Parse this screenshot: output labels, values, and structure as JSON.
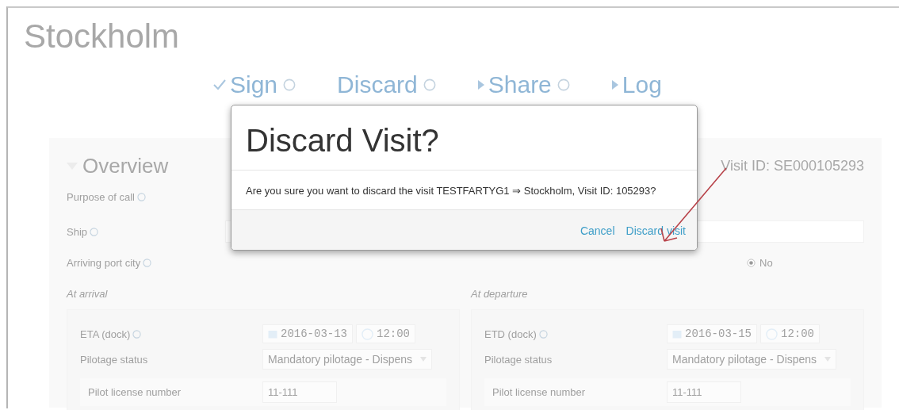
{
  "page": {
    "title": "Stockholm"
  },
  "actions": [
    {
      "kind": "check",
      "label": "Sign",
      "help": true
    },
    {
      "kind": "plain",
      "label": "Discard",
      "help": true
    },
    {
      "kind": "caret",
      "label": "Share",
      "help": true
    },
    {
      "kind": "caret",
      "label": "Log",
      "help": false
    }
  ],
  "overview": {
    "heading": "Overview",
    "expanded": true,
    "visit_id": "Visit ID: SE000105293",
    "fields": [
      {
        "label": "Purpose of call",
        "kind": "text"
      },
      {
        "label": "Ship",
        "kind": "input"
      },
      {
        "label": "Arriving port city",
        "kind": "radio",
        "options": [
          {
            "label": "No",
            "selected": true
          }
        ]
      }
    ]
  },
  "sections": [
    {
      "title": "At arrival",
      "time_label": "ETA (dock)",
      "date": "2016-03-13",
      "time": "12:00",
      "pilotage_label": "Pilotage status",
      "pilotage": "Mandatory pilotage - Dispens",
      "license_label": "Pilot license number",
      "license": "11-111"
    },
    {
      "title": "At departure",
      "time_label": "ETD (dock)",
      "date": "2016-03-15",
      "time": "12:00",
      "pilotage_label": "Pilotage status",
      "pilotage": "Mandatory pilotage - Dispens",
      "license_label": "Pilot license number",
      "license": "11-111"
    }
  ],
  "dialog": {
    "title": "Discard Visit?",
    "message": "Are you sure you want to discard the visit TESTFARTYG1 ⇒ Stockholm, Visit ID: 105293?",
    "buttons": [
      {
        "label": "Cancel"
      },
      {
        "label": "Discard visit"
      }
    ]
  }
}
